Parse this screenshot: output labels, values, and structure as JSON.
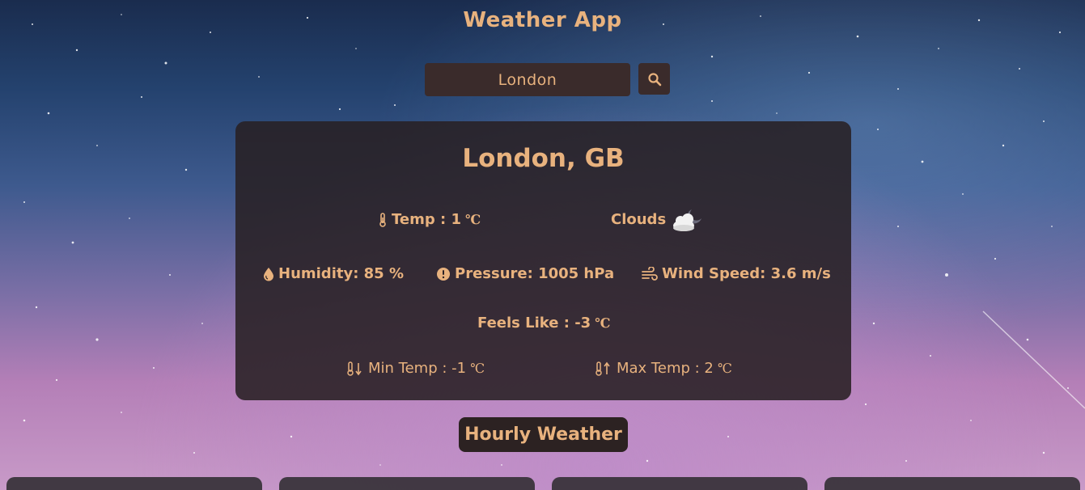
{
  "app": {
    "title": "Weather App"
  },
  "search": {
    "value": "London"
  },
  "current": {
    "location": "London, GB",
    "temp": "Temp : 1",
    "condition": "Clouds",
    "humidity": "Humidity: 85 %",
    "pressure": "Pressure: 1005 hPa",
    "wind": "Wind Speed: 3.6 m/s",
    "feels_like": "Feels Like : -3",
    "min_temp": "Min Temp : -1",
    "max_temp": "Max Temp : 2",
    "unit": "℃"
  },
  "hourly": {
    "title": "Hourly Weather",
    "card_count": 4
  },
  "colors": {
    "accent": "#e8b27e",
    "card_bg": "#282023",
    "button_bg": "#3a2b2b"
  },
  "icons": {
    "search": "magnifier-icon",
    "temp": "thermometer-icon",
    "weather": "cloud-moon-icon",
    "humidity": "droplet-icon",
    "pressure": "info-circle-icon",
    "wind": "wind-icon",
    "min": "thermometer-down-icon",
    "max": "thermometer-up-icon"
  }
}
